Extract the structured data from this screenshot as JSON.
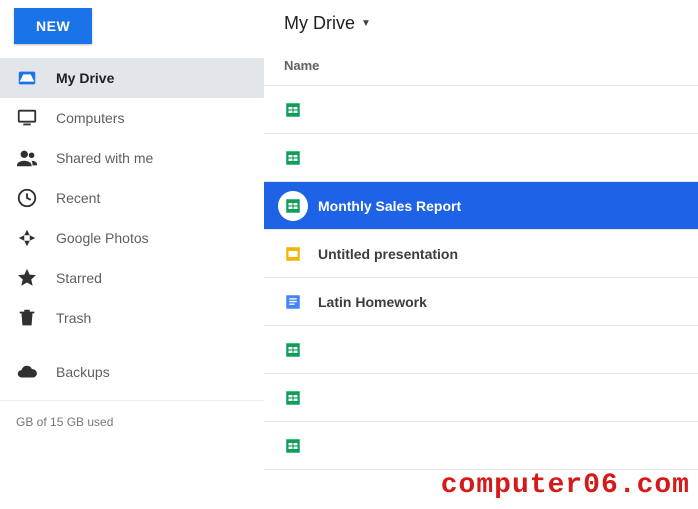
{
  "new_button_label": "NEW",
  "breadcrumb": {
    "title": "My Drive"
  },
  "column_header": "Name",
  "sidebar": {
    "items": [
      {
        "id": "my-drive",
        "label": "My Drive",
        "icon": "drive-icon",
        "active": true
      },
      {
        "id": "computers",
        "label": "Computers",
        "icon": "computer-icon",
        "active": false
      },
      {
        "id": "shared",
        "label": "Shared with me",
        "icon": "people-icon",
        "active": false
      },
      {
        "id": "recent",
        "label": "Recent",
        "icon": "clock-icon",
        "active": false
      },
      {
        "id": "photos",
        "label": "Google Photos",
        "icon": "photos-icon",
        "active": false
      },
      {
        "id": "starred",
        "label": "Starred",
        "icon": "star-icon",
        "active": false
      },
      {
        "id": "trash",
        "label": "Trash",
        "icon": "trash-icon",
        "active": false
      },
      {
        "id": "backups",
        "label": "Backups",
        "icon": "cloud-icon",
        "active": false
      }
    ]
  },
  "storage_text": "GB of 15 GB used",
  "files": [
    {
      "type": "sheet",
      "name": "",
      "selected": false
    },
    {
      "type": "sheet",
      "name": "",
      "selected": false
    },
    {
      "type": "sheet",
      "name": "Monthly Sales Report",
      "selected": true
    },
    {
      "type": "slides",
      "name": "Untitled presentation",
      "selected": false
    },
    {
      "type": "doc",
      "name": "Latin Homework",
      "selected": false
    },
    {
      "type": "sheet",
      "name": "",
      "selected": false
    },
    {
      "type": "sheet",
      "name": "",
      "selected": false
    },
    {
      "type": "sheet",
      "name": "",
      "selected": false
    }
  ],
  "watermark": "computer06.com"
}
